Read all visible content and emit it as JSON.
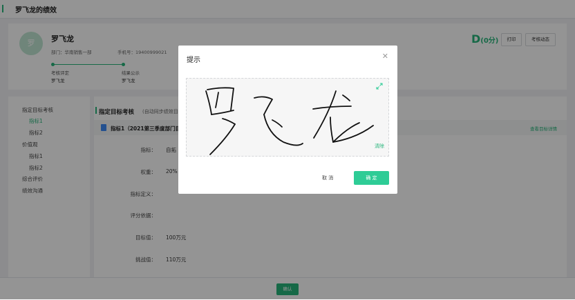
{
  "header": {
    "title": "罗飞龙的绩效"
  },
  "profile": {
    "avatar_text": "罗",
    "name": "罗飞龙",
    "department": "部门：华南销售一部",
    "phone": "手机号：19400999021",
    "grade": "D",
    "score": "(0分)",
    "print_label": "打印",
    "dynamics_label": "考核动态",
    "steps": [
      {
        "label": "考核评定",
        "person": "罗飞龙"
      },
      {
        "label": "结果公示",
        "person": "罗飞龙"
      }
    ]
  },
  "sidebar": {
    "items": [
      {
        "label": "指定目标考核"
      },
      {
        "label": "指标1"
      },
      {
        "label": "指标2"
      },
      {
        "label": "价值观"
      },
      {
        "label": "指标1"
      },
      {
        "label": "指标2"
      },
      {
        "label": "综合评价"
      },
      {
        "label": "绩效沟通"
      }
    ]
  },
  "main": {
    "section_title": "指定目标考核",
    "section_subtitle": "(自动同步绩效目",
    "indicator_title": "指标1（2021第三季度部门目",
    "indicator_link": "查看目标详情",
    "rows": [
      {
        "label": "指标：",
        "value": "自拓"
      },
      {
        "label": "权重：",
        "value": "20%"
      },
      {
        "label": "指标定义：",
        "value": ""
      },
      {
        "label": "评分依据：",
        "value": ""
      },
      {
        "label": "目标值：",
        "value": "100万元"
      },
      {
        "label": "挑战值：",
        "value": "110万元"
      }
    ]
  },
  "footer": {
    "confirm_label": "确认"
  },
  "dialog": {
    "title": "提示",
    "close_icon": "close-icon",
    "clear_label": "清除",
    "cancel_label": "取 消",
    "ok_label": "确 定"
  },
  "colors": {
    "accent": "#27b57a",
    "ok_button": "#2ecc96"
  }
}
